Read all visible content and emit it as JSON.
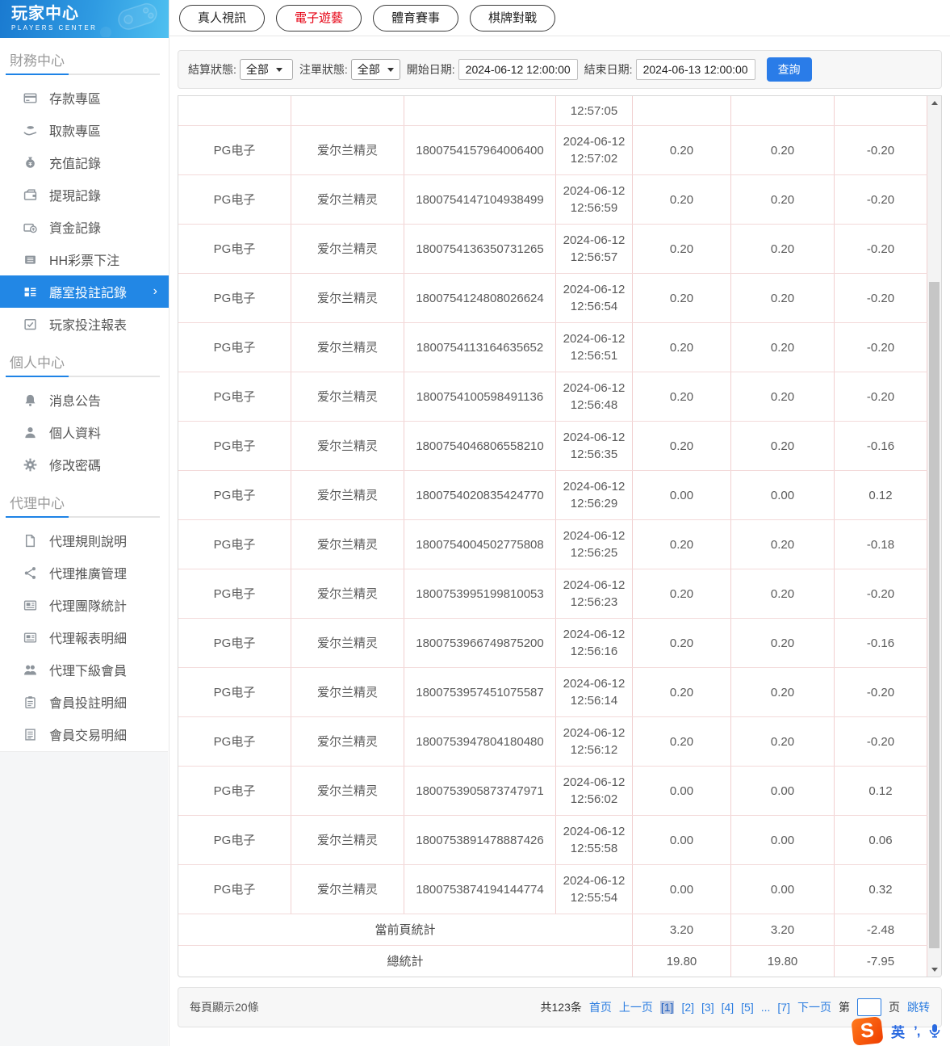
{
  "colors": {
    "accent_blue": "#2a7ce0",
    "active_tab_red": "#e60012",
    "sidebar_active_bg": "#2287e5",
    "header_gradient_start": "#1a7ad0",
    "header_gradient_end": "#4fc0f0",
    "table_border_pink": "#f1d0d0",
    "search_button_bg": "#2a7ce8",
    "sogou_orange": "#ef4a00"
  },
  "sidebar": {
    "title": "玩家中心",
    "subtitle": "PLAYERS CENTER",
    "sections": [
      {
        "heading": "財務中心",
        "items": [
          {
            "label": "存款專區",
            "icon": "deposit-icon",
            "active": false
          },
          {
            "label": "取款專區",
            "icon": "withdraw-icon",
            "active": false
          },
          {
            "label": "充值記錄",
            "icon": "recharge-icon",
            "active": false
          },
          {
            "label": "提現記錄",
            "icon": "cashout-icon",
            "active": false
          },
          {
            "label": "資金記錄",
            "icon": "funds-icon",
            "active": false
          },
          {
            "label": "HH彩票下注",
            "icon": "lottery-icon",
            "active": false
          },
          {
            "label": "廳室投註記錄",
            "icon": "bet-records-icon",
            "active": true
          },
          {
            "label": "玩家投注報表",
            "icon": "report-icon",
            "active": false
          }
        ]
      },
      {
        "heading": "個人中心",
        "items": [
          {
            "label": "消息公告",
            "icon": "bell-icon",
            "active": false
          },
          {
            "label": "個人資料",
            "icon": "profile-icon",
            "active": false
          },
          {
            "label": "修改密碼",
            "icon": "gear-icon",
            "active": false
          }
        ]
      },
      {
        "heading": "代理中心",
        "items": [
          {
            "label": "代理規則說明",
            "icon": "doc-icon",
            "active": false
          },
          {
            "label": "代理推廣管理",
            "icon": "share-icon",
            "active": false
          },
          {
            "label": "代理團隊統計",
            "icon": "team-stats-icon",
            "active": false
          },
          {
            "label": "代理報表明細",
            "icon": "report-detail-icon",
            "active": false
          },
          {
            "label": "代理下級會員",
            "icon": "members-icon",
            "active": false
          },
          {
            "label": "會員投註明細",
            "icon": "member-bets-icon",
            "active": false
          },
          {
            "label": "會員交易明細",
            "icon": "member-trans-icon",
            "active": false
          }
        ]
      }
    ]
  },
  "tabs": [
    {
      "label": "真人視訊",
      "active": false
    },
    {
      "label": "電子遊藝",
      "active": true
    },
    {
      "label": "體育賽事",
      "active": false
    },
    {
      "label": "棋牌對戰",
      "active": false
    }
  ],
  "filters": {
    "settle_status_label": "結算狀態:",
    "settle_status_value": "全部",
    "order_status_label": "注單狀態:",
    "order_status_value": "全部",
    "start_date_label": "開始日期:",
    "start_date_value": "2024-06-12 12:00:00",
    "end_date_label": "結束日期:",
    "end_date_value": "2024-06-13 12:00:00",
    "search_button": "查詢"
  },
  "table": {
    "partial_row_time": "12:57:05",
    "rows": [
      {
        "platform": "PG电子",
        "game": "爱尔兰精灵",
        "order_id": "1800754157964006400",
        "date": "2024-06-12",
        "time": "12:57:02",
        "bet": "0.20",
        "valid": "0.20",
        "winloss": "-0.20"
      },
      {
        "platform": "PG电子",
        "game": "爱尔兰精灵",
        "order_id": "1800754147104938499",
        "date": "2024-06-12",
        "time": "12:56:59",
        "bet": "0.20",
        "valid": "0.20",
        "winloss": "-0.20"
      },
      {
        "platform": "PG电子",
        "game": "爱尔兰精灵",
        "order_id": "1800754136350731265",
        "date": "2024-06-12",
        "time": "12:56:57",
        "bet": "0.20",
        "valid": "0.20",
        "winloss": "-0.20"
      },
      {
        "platform": "PG电子",
        "game": "爱尔兰精灵",
        "order_id": "1800754124808026624",
        "date": "2024-06-12",
        "time": "12:56:54",
        "bet": "0.20",
        "valid": "0.20",
        "winloss": "-0.20"
      },
      {
        "platform": "PG电子",
        "game": "爱尔兰精灵",
        "order_id": "1800754113164635652",
        "date": "2024-06-12",
        "time": "12:56:51",
        "bet": "0.20",
        "valid": "0.20",
        "winloss": "-0.20"
      },
      {
        "platform": "PG电子",
        "game": "爱尔兰精灵",
        "order_id": "1800754100598491136",
        "date": "2024-06-12",
        "time": "12:56:48",
        "bet": "0.20",
        "valid": "0.20",
        "winloss": "-0.20"
      },
      {
        "platform": "PG电子",
        "game": "爱尔兰精灵",
        "order_id": "1800754046806558210",
        "date": "2024-06-12",
        "time": "12:56:35",
        "bet": "0.20",
        "valid": "0.20",
        "winloss": "-0.16"
      },
      {
        "platform": "PG电子",
        "game": "爱尔兰精灵",
        "order_id": "1800754020835424770",
        "date": "2024-06-12",
        "time": "12:56:29",
        "bet": "0.00",
        "valid": "0.00",
        "winloss": "0.12"
      },
      {
        "platform": "PG电子",
        "game": "爱尔兰精灵",
        "order_id": "1800754004502775808",
        "date": "2024-06-12",
        "time": "12:56:25",
        "bet": "0.20",
        "valid": "0.20",
        "winloss": "-0.18"
      },
      {
        "platform": "PG电子",
        "game": "爱尔兰精灵",
        "order_id": "1800753995199810053",
        "date": "2024-06-12",
        "time": "12:56:23",
        "bet": "0.20",
        "valid": "0.20",
        "winloss": "-0.20"
      },
      {
        "platform": "PG电子",
        "game": "爱尔兰精灵",
        "order_id": "1800753966749875200",
        "date": "2024-06-12",
        "time": "12:56:16",
        "bet": "0.20",
        "valid": "0.20",
        "winloss": "-0.16"
      },
      {
        "platform": "PG电子",
        "game": "爱尔兰精灵",
        "order_id": "1800753957451075587",
        "date": "2024-06-12",
        "time": "12:56:14",
        "bet": "0.20",
        "valid": "0.20",
        "winloss": "-0.20"
      },
      {
        "platform": "PG电子",
        "game": "爱尔兰精灵",
        "order_id": "1800753947804180480",
        "date": "2024-06-12",
        "time": "12:56:12",
        "bet": "0.20",
        "valid": "0.20",
        "winloss": "-0.20"
      },
      {
        "platform": "PG电子",
        "game": "爱尔兰精灵",
        "order_id": "1800753905873747971",
        "date": "2024-06-12",
        "time": "12:56:02",
        "bet": "0.00",
        "valid": "0.00",
        "winloss": "0.12"
      },
      {
        "platform": "PG电子",
        "game": "爱尔兰精灵",
        "order_id": "1800753891478887426",
        "date": "2024-06-12",
        "time": "12:55:58",
        "bet": "0.00",
        "valid": "0.00",
        "winloss": "0.06"
      },
      {
        "platform": "PG电子",
        "game": "爱尔兰精灵",
        "order_id": "1800753874194144774",
        "date": "2024-06-12",
        "time": "12:55:54",
        "bet": "0.00",
        "valid": "0.00",
        "winloss": "0.32"
      }
    ],
    "page_summary": {
      "label": "當前頁統計",
      "bet": "3.20",
      "valid": "3.20",
      "winloss": "-2.48"
    },
    "total_summary": {
      "label": "總統計",
      "bet": "19.80",
      "valid": "19.80",
      "winloss": "-7.95"
    }
  },
  "pagination": {
    "page_size_text": "每頁顯示20條",
    "total_text": "共123条",
    "first": "首页",
    "prev": "上一页",
    "pages": [
      "[1]",
      "[2]",
      "[3]",
      "[4]",
      "[5]",
      "...",
      "[7]"
    ],
    "next": "下一页",
    "jump_prefix": "第",
    "jump_suffix": "页",
    "jump_button": "跳转"
  },
  "ime": {
    "logo_letter": "S",
    "lang_indicator": "英",
    "punct_indicator": "’,"
  }
}
